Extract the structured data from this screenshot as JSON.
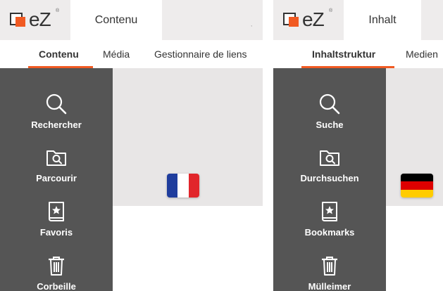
{
  "panels": {
    "fr": {
      "logo_text": "eZ",
      "logo_mark": "®",
      "active_tab": "Contenu",
      "subnav": [
        "Contenu",
        "Média",
        "Gestionnaire de liens"
      ],
      "sidebar": [
        {
          "label": "Rechercher",
          "icon": "search-icon"
        },
        {
          "label": "Parcourir",
          "icon": "browse-folder-icon"
        },
        {
          "label": "Favoris",
          "icon": "bookmark-icon"
        },
        {
          "label": "Corbeille",
          "icon": "trash-icon"
        }
      ],
      "flag": {
        "name": "france-flag",
        "colors": [
          "#1f3d9d",
          "#ffffff",
          "#e1262b"
        ]
      }
    },
    "de": {
      "logo_text": "eZ",
      "logo_mark": "®",
      "active_tab": "Inhalt",
      "subnav": [
        "Inhaltstruktur",
        "Medien"
      ],
      "sidebar": [
        {
          "label": "Suche",
          "icon": "search-icon"
        },
        {
          "label": "Durchsuchen",
          "icon": "browse-folder-icon"
        },
        {
          "label": "Bookmarks",
          "icon": "bookmark-icon"
        },
        {
          "label": "Mülleimer",
          "icon": "trash-icon"
        }
      ],
      "flag": {
        "name": "germany-flag",
        "colors": [
          "#000000",
          "#dd0000",
          "#ffcc00"
        ]
      }
    }
  },
  "colors": {
    "accent": "#f15a22",
    "sidebar_bg": "#555555",
    "topbar_bg": "#eeecec"
  }
}
